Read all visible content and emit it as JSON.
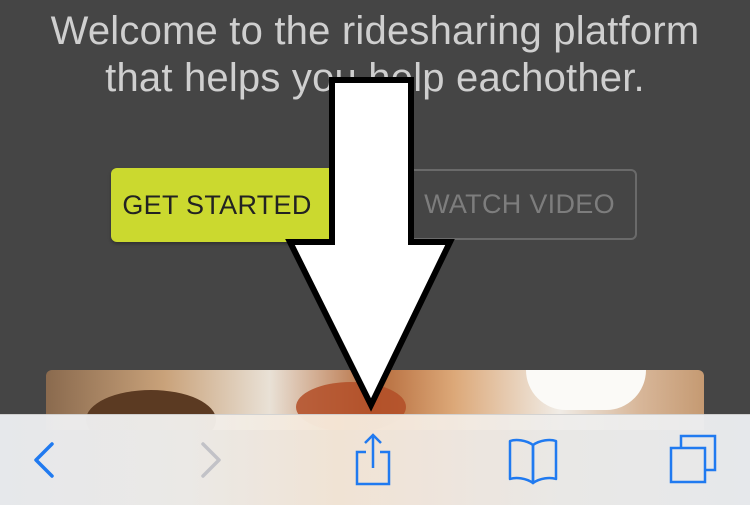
{
  "hero": {
    "title_line1": "Welcome to the ridesharing platform",
    "title_line2": "that helps you help eachother."
  },
  "buttons": {
    "get_started": "GET STARTED",
    "watch_video": "WATCH VIDEO"
  },
  "colors": {
    "background": "#454545",
    "accent": "#cbd92f",
    "ios_blue": "#1f7cf6"
  },
  "toolbar": {
    "items": [
      {
        "name": "back",
        "icon": "chevron-left-icon",
        "enabled": true
      },
      {
        "name": "forward",
        "icon": "chevron-right-icon",
        "enabled": false
      },
      {
        "name": "share",
        "icon": "share-icon",
        "enabled": true
      },
      {
        "name": "bookmarks",
        "icon": "book-icon",
        "enabled": true
      },
      {
        "name": "tabs",
        "icon": "tabs-icon",
        "enabled": true
      }
    ]
  }
}
